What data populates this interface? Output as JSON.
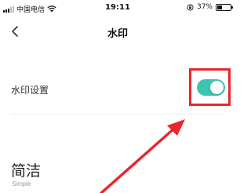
{
  "status_bar": {
    "carrier": "中国电信",
    "time": "19:11",
    "battery": "37%",
    "battery_level": 0.37,
    "icons": [
      "signal-icon",
      "wifi-icon",
      "rotation-lock-icon",
      "battery-icon"
    ]
  },
  "nav": {
    "title": "水印",
    "back_icon": "chevron-left-icon"
  },
  "settings": {
    "watermark_label": "水印设置",
    "watermark_enabled": true
  },
  "style_option": {
    "title": "简洁",
    "subtitle": "Simple"
  },
  "colors": {
    "toggle_on": "#3bc5b1",
    "annotation_red": "#e8262c"
  }
}
